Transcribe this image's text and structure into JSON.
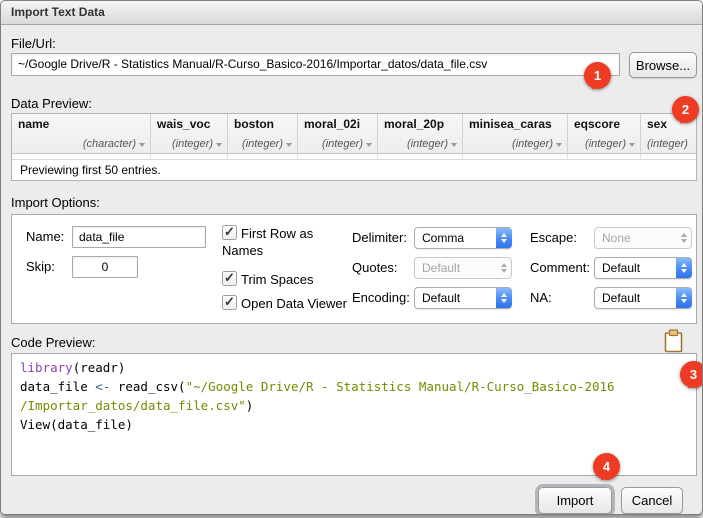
{
  "window": {
    "title": "Import Text Data"
  },
  "file_url": {
    "label": "File/Url:",
    "value": "~/Google Drive/R - Statistics Manual/R-Curso_Basico-2016/Importar_datos/data_file.csv",
    "browse_label": "Browse..."
  },
  "data_preview": {
    "label": "Data Preview:",
    "columns": [
      {
        "name": "name",
        "type": "(character)"
      },
      {
        "name": "wais_voc",
        "type": "(integer)"
      },
      {
        "name": "boston",
        "type": "(integer)"
      },
      {
        "name": "moral_02i",
        "type": "(integer)"
      },
      {
        "name": "moral_20p",
        "type": "(integer)"
      },
      {
        "name": "minisea_caras",
        "type": "(integer)"
      },
      {
        "name": "eqscore",
        "type": "(integer)"
      },
      {
        "name": "sex",
        "type": "(integer)"
      }
    ],
    "status": "Previewing first 50 entries."
  },
  "import_options": {
    "label": "Import Options:",
    "name_label": "Name:",
    "name_value": "data_file",
    "skip_label": "Skip:",
    "skip_value": "0",
    "checkboxes": [
      {
        "label": "First Row as Names",
        "checked": true
      },
      {
        "label": "Trim Spaces",
        "checked": true
      },
      {
        "label": "Open Data Viewer",
        "checked": true
      }
    ],
    "selects": [
      {
        "label": "Delimiter:",
        "value": "Comma",
        "enabled": true
      },
      {
        "label": "Escape:",
        "value": "None",
        "enabled": false
      },
      {
        "label": "Quotes:",
        "value": "Default",
        "enabled": false
      },
      {
        "label": "Comment:",
        "value": "Default",
        "enabled": true
      },
      {
        "label": "Encoding:",
        "value": "Default",
        "enabled": true
      },
      {
        "label": "NA:",
        "value": "Default",
        "enabled": true
      }
    ]
  },
  "code_preview": {
    "label": "Code Preview:",
    "lines": [
      [
        {
          "text": "library",
          "type": "keyword"
        },
        {
          "text": "(readr)",
          "type": "plain"
        }
      ],
      [
        {
          "text": "data_file ",
          "type": "plain"
        },
        {
          "text": "<-",
          "type": "operator"
        },
        {
          "text": " read_csv(",
          "type": "plain"
        },
        {
          "text": "\"~/Google Drive/R - Statistics Manual/R-Curso_Basico-2016",
          "type": "string"
        }
      ],
      [
        {
          "text": "/Importar_datos/data_file.csv\"",
          "type": "string"
        },
        {
          "text": ")",
          "type": "plain"
        }
      ],
      [
        {
          "text": "View(data_file)",
          "type": "plain"
        }
      ]
    ]
  },
  "footer": {
    "import_label": "Import",
    "cancel_label": "Cancel"
  },
  "badges": {
    "b1": "1",
    "b2": "2",
    "b3": "3",
    "b4": "4"
  },
  "colors": {
    "badge_red": "#ee3b24",
    "select_blue": "#3a7ef0",
    "keyword_purple": "#8f44ad",
    "string_green": "#718c00",
    "operator_blue": "#36648b"
  }
}
